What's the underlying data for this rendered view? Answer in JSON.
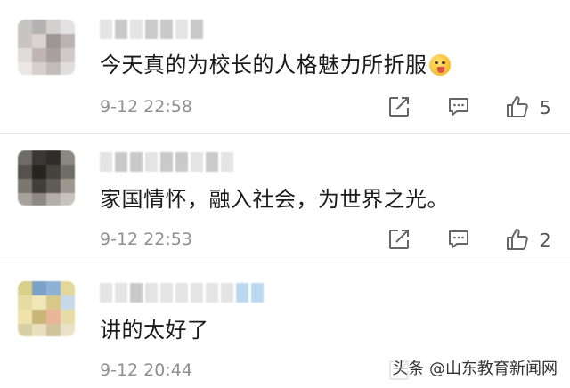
{
  "comments": [
    {
      "text": "今天真的为校长的人格魅力所折服",
      "emoji": "face-savoring-food-emoji",
      "time": "9-12 22:58",
      "likes": "5"
    },
    {
      "text": "家国情怀，融入社会，为世界之光。",
      "time": "9-12 22:53",
      "likes": "2"
    },
    {
      "text": "讲的太好了",
      "time": "9-12 20:44",
      "likes": ""
    }
  ],
  "watermark": {
    "text": "头条 @山东教育新闻网"
  },
  "icons": {
    "share": "share-icon",
    "reply": "reply-icon",
    "like": "thumbs-up-icon"
  },
  "colors": {
    "text": "#1a1a1a",
    "meta": "#8f8f8f",
    "icon": "#666666"
  }
}
